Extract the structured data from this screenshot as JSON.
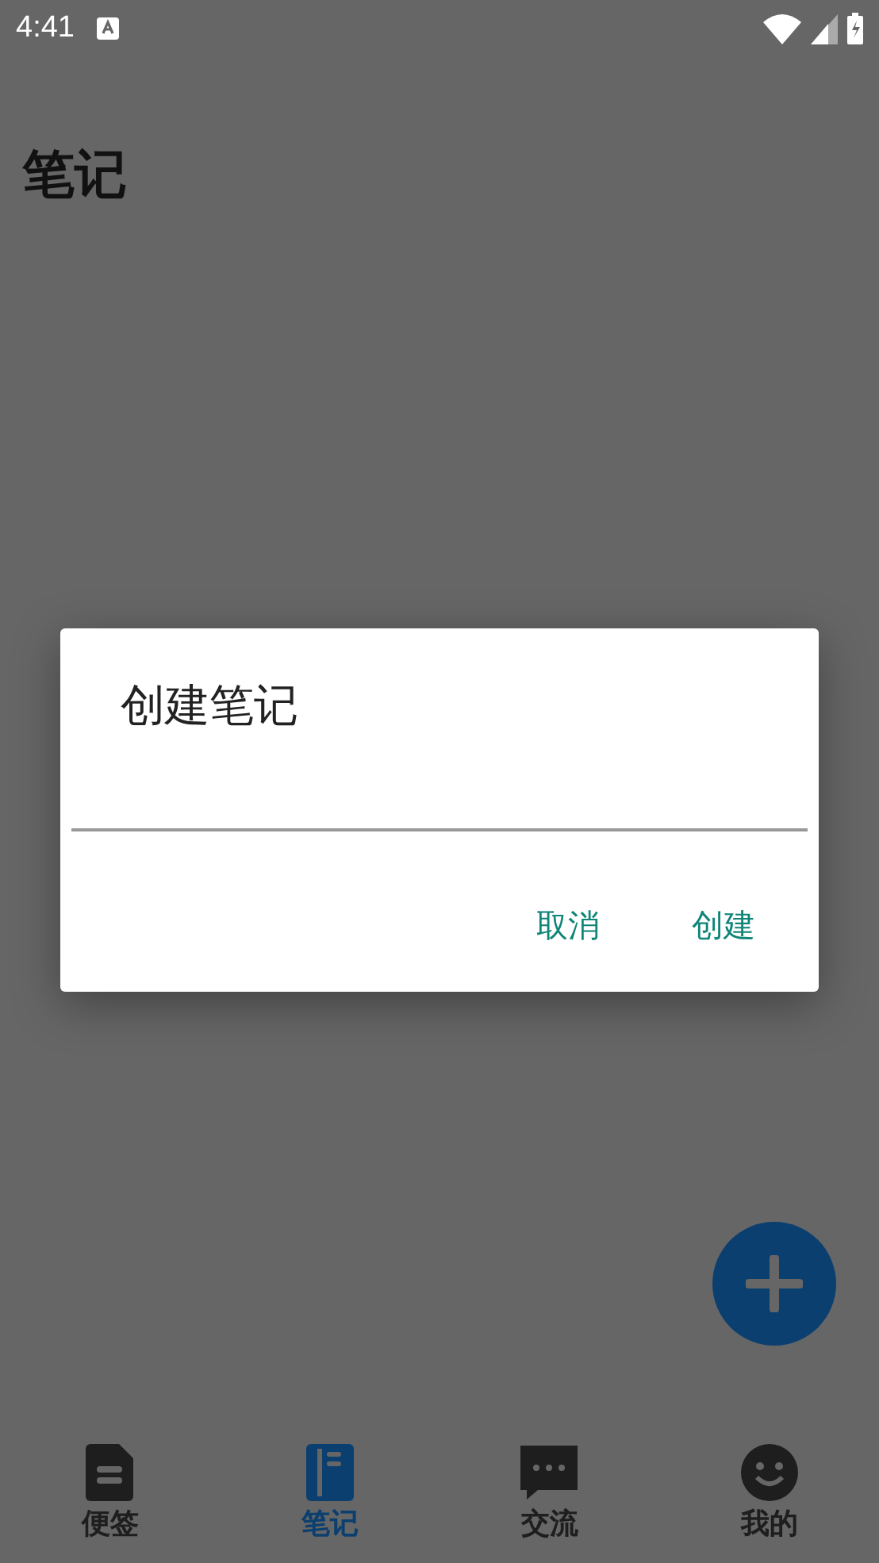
{
  "status_bar": {
    "time": "4:41"
  },
  "page": {
    "title": "笔记"
  },
  "dialog": {
    "title": "创建笔记",
    "buttons": [
      "取消",
      "创建"
    ]
  },
  "bottom_nav": [
    {
      "label": "便签",
      "selected": false
    },
    {
      "label": "笔记",
      "selected": true
    },
    {
      "label": "交流",
      "selected": false
    },
    {
      "label": "我的",
      "selected": false
    }
  ]
}
